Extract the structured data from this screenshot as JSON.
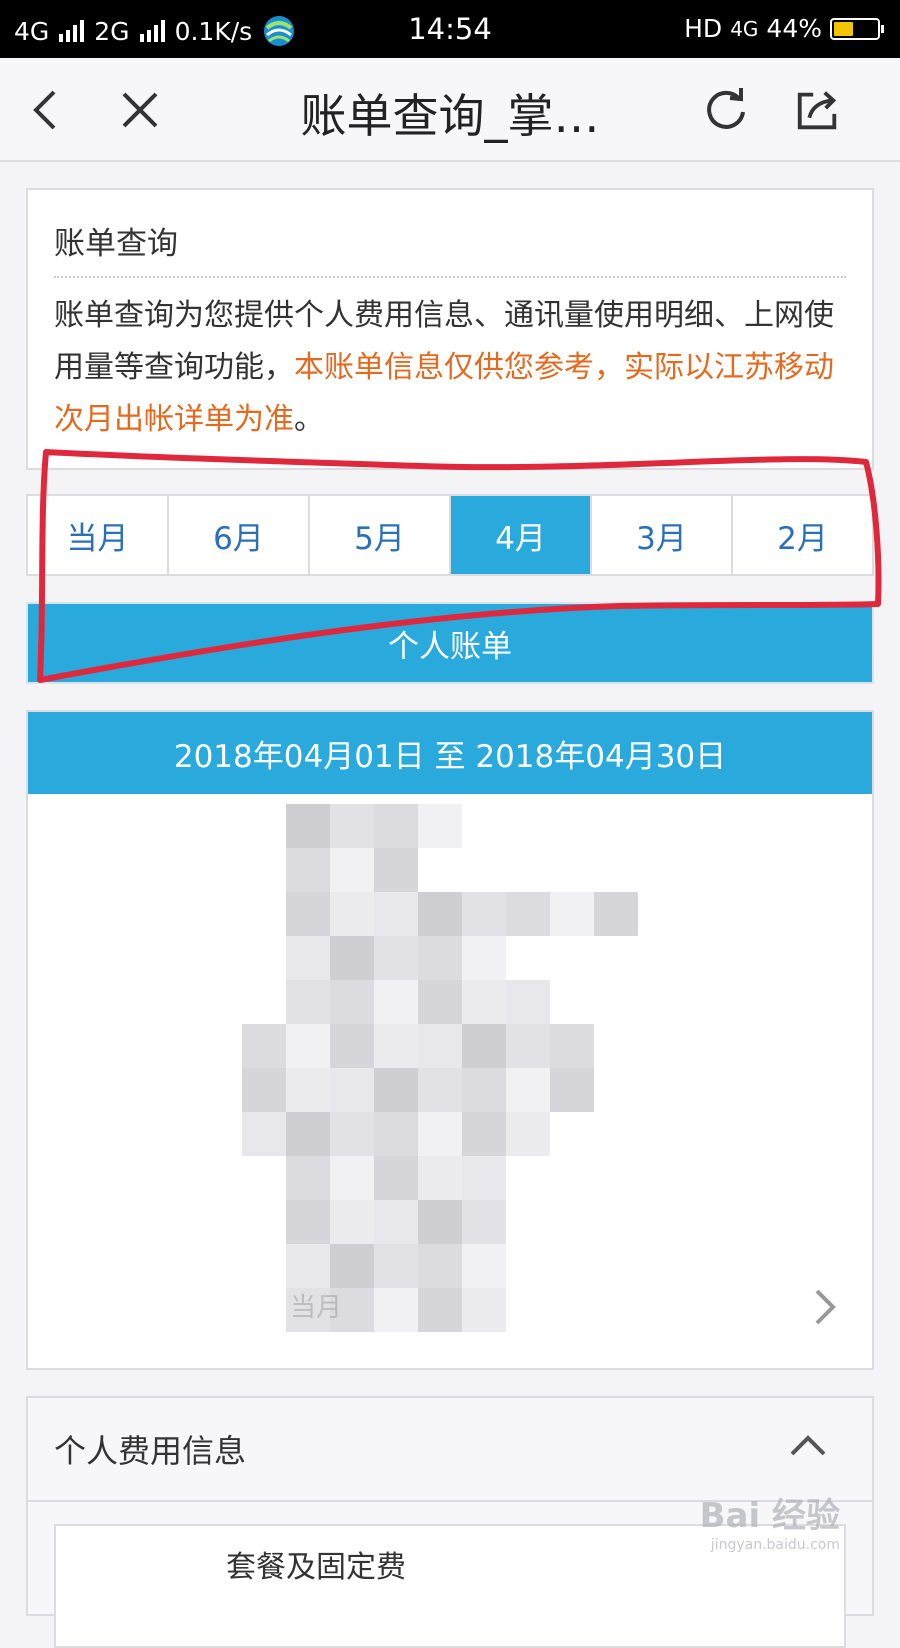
{
  "status_bar": {
    "network1": "4G",
    "network2": "2G",
    "speed": "0.1K/s",
    "time": "14:54",
    "hd": "HD",
    "data_type": "4G",
    "battery": "44%",
    "battery_level": 0.44
  },
  "navbar": {
    "title": "账单查询_掌…"
  },
  "info_card": {
    "title": "账单查询",
    "desc_normal": "账单查询为您提供个人费用信息、通讯量使用明细、上网使用量等查询功能，",
    "desc_highlight": "本账单信息仅供您参考，实际以江苏移动次月出帐详单为准",
    "desc_end": "。"
  },
  "months": {
    "tabs": [
      "当月",
      "6月",
      "5月",
      "4月",
      "3月",
      "2月"
    ],
    "active_index": 3
  },
  "bill_button": "个人账单",
  "period": {
    "range": "2018年04月01日 至 2018年04月30日",
    "row_label": "当月"
  },
  "fee_section": {
    "title": "个人费用信息",
    "item": "套餐及固定费"
  },
  "watermark": {
    "brand": "Bai 经验",
    "url": "jingyan.baidu.com"
  },
  "colors": {
    "accent": "#2aa9dd",
    "highlight": "#e36a1f",
    "annotation": "#e0283c"
  }
}
